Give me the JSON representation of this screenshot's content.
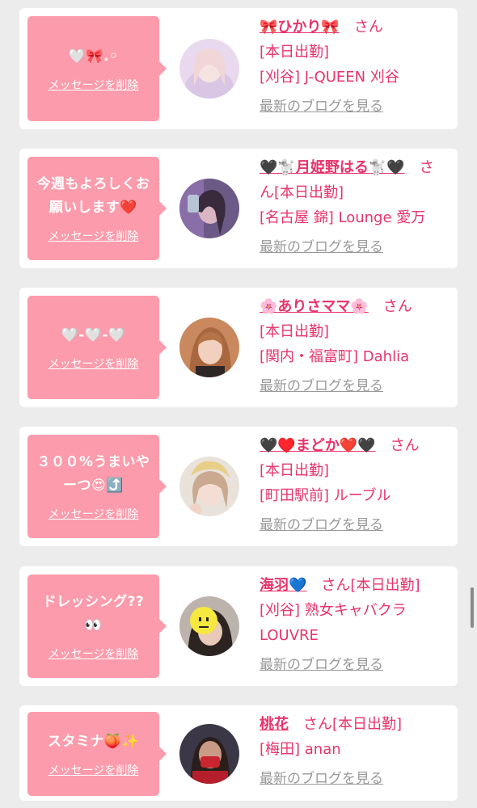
{
  "cards": [
    {
      "message": "🤍🎀.◦",
      "delete_label": "メッセージを削除",
      "name": "🎀ひかり🎀",
      "suffix": "　さん",
      "line_rest": "[本日出勤]",
      "shop": "[刈谷] J-QUEEN 刈谷",
      "blog_label": "最新のブログを見る"
    },
    {
      "message": "今週もよろしくお願いします❤️",
      "delete_label": "メッセージを削除",
      "name": "🖤🐩月姫野はる🐩🖤",
      "suffix": "　さ",
      "line_rest": "ん[本日出勤]",
      "shop": "[名古屋 錦] Lounge 愛万",
      "blog_label": "最新のブログを見る"
    },
    {
      "message": "🤍-🤍-🤍",
      "delete_label": "メッセージを削除",
      "name": "🌸ありさママ🌸",
      "suffix": "　さん",
      "line_rest": "[本日出勤]",
      "shop": "[関内・福富町] Dahlia",
      "blog_label": "最新のブログを見る"
    },
    {
      "message": "３００%うまいやーつ😍⤴️",
      "delete_label": "メッセージを削除",
      "name": "🖤♥️まどか❤️🖤",
      "suffix": "　さん",
      "line_rest": "[本日出勤]",
      "shop": "[町田駅前] ルーブル",
      "blog_label": "最新のブログを見る"
    },
    {
      "message": "ドレッシング??👀",
      "delete_label": "メッセージを削除",
      "name": "海羽💙",
      "suffix": "　さん[本日出勤]",
      "line_rest": "",
      "shop": "[刈谷] 熟女キャバクラLOUVRE",
      "blog_label": "最新のブログを見る"
    },
    {
      "message": "スタミナ🍑✨",
      "delete_label": "メッセージを削除",
      "name": "桃花",
      "suffix": "　さん[本日出勤]",
      "line_rest": "",
      "shop": "[梅田] anan",
      "blog_label": "最新のブログを見る"
    }
  ],
  "colors": {
    "bubble": "#fc9bab",
    "accent": "#e8336b",
    "link_gray": "#999999",
    "background": "#ececec"
  }
}
